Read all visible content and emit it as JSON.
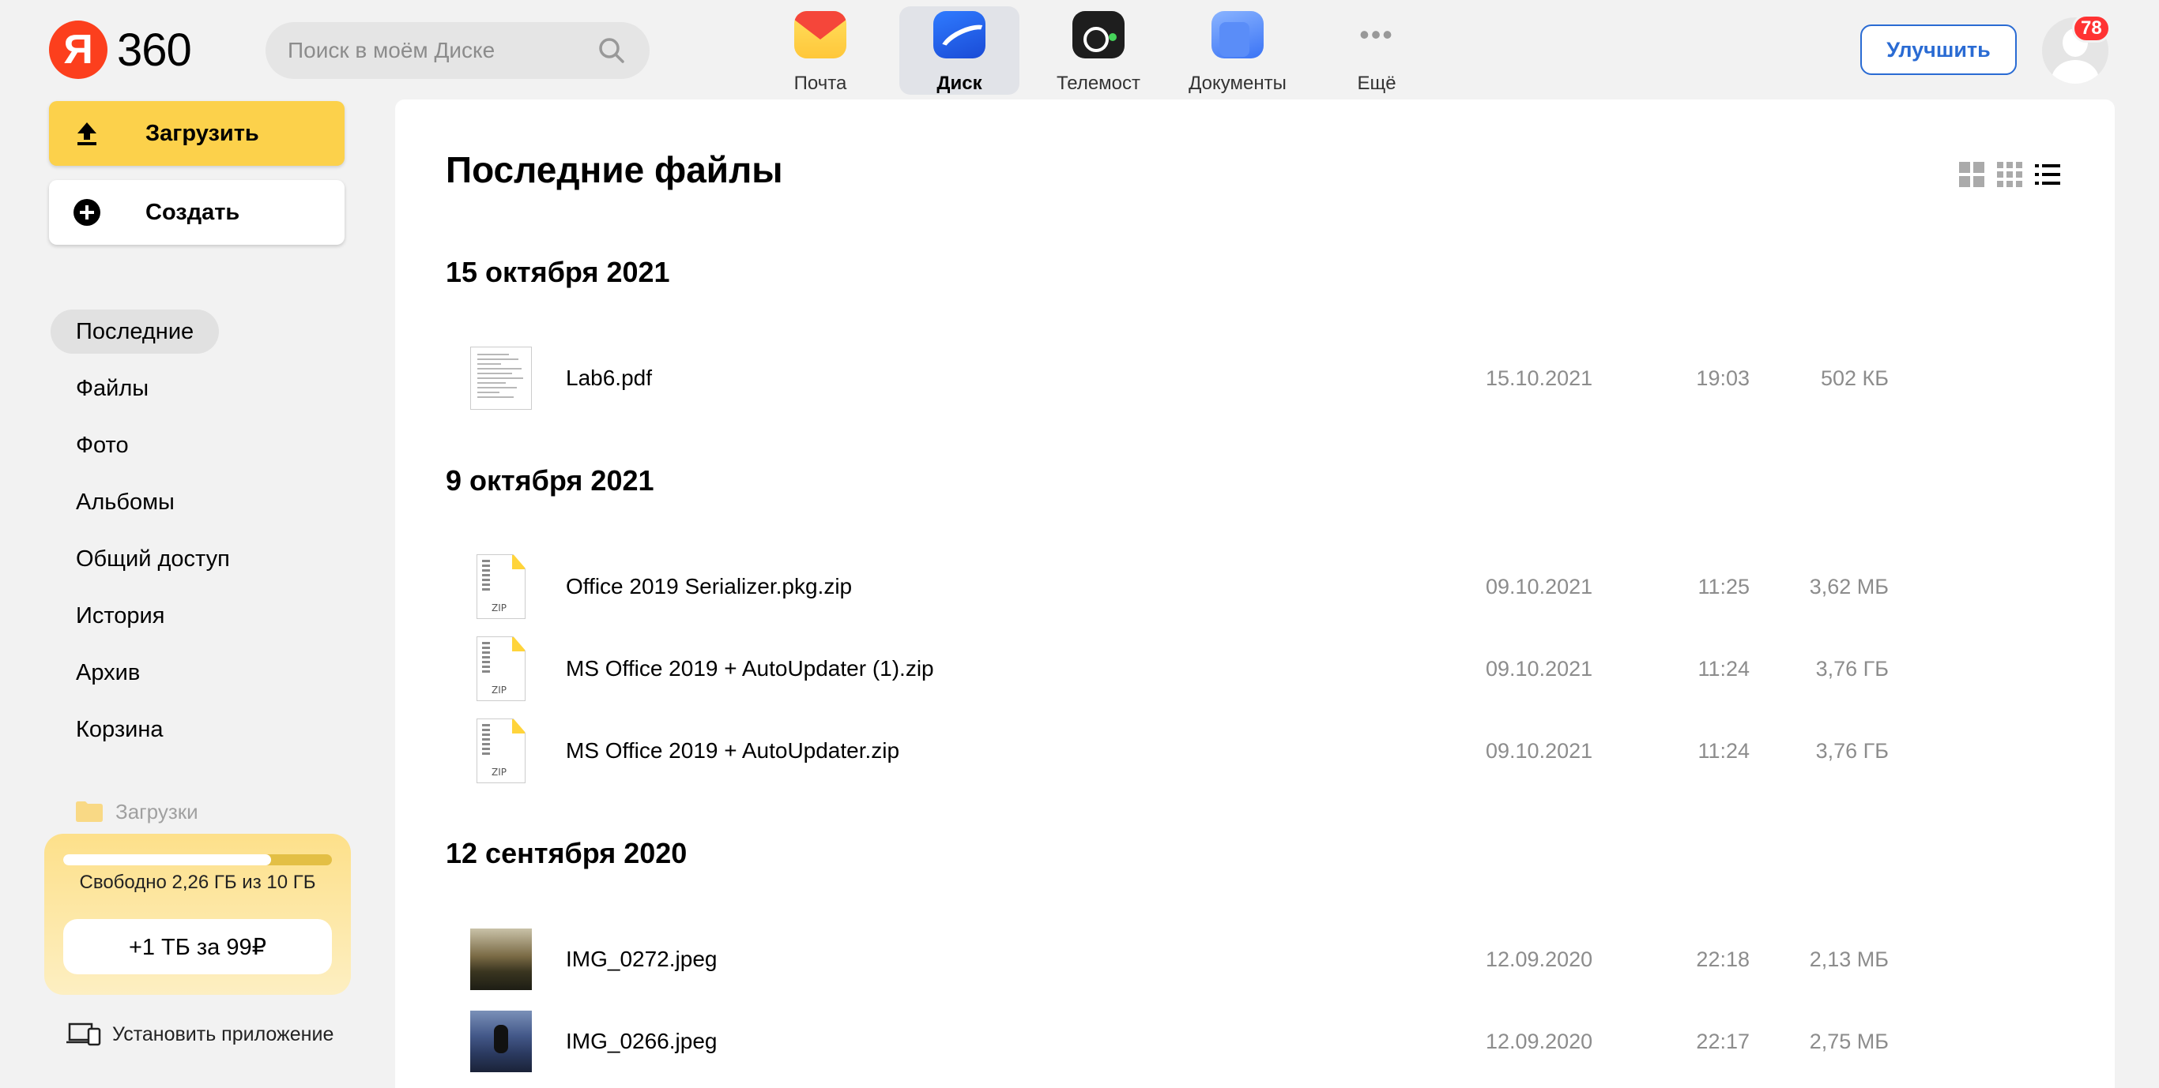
{
  "header": {
    "logo_mark": "Я",
    "logo_text": "360",
    "search_placeholder": "Поиск в моём Диске",
    "apps": [
      {
        "label": "Почта",
        "icon": "mail-icon"
      },
      {
        "label": "Диск",
        "icon": "disk-icon",
        "active": true
      },
      {
        "label": "Телемост",
        "icon": "telemost-icon"
      },
      {
        "label": "Документы",
        "icon": "documents-icon"
      },
      {
        "label": "Ещё",
        "icon": "more-icon"
      }
    ],
    "upgrade_label": "Улучшить",
    "notifications_count": "78",
    "colors": {
      "accent": "#2a6bd3",
      "brand_red": "#fc3f1d",
      "badge": "#ff3333"
    }
  },
  "sidebar": {
    "upload_label": "Загрузить",
    "create_label": "Создать",
    "upload_color": "#fcd14b",
    "items": [
      {
        "label": "Последние",
        "active": true
      },
      {
        "label": "Файлы"
      },
      {
        "label": "Фото"
      },
      {
        "label": "Альбомы"
      },
      {
        "label": "Общий доступ"
      },
      {
        "label": "История"
      },
      {
        "label": "Архив"
      },
      {
        "label": "Корзина"
      }
    ],
    "folder_label": "Загрузки",
    "storage": {
      "text": "Свободно 2,26 ГБ из 10 ГБ",
      "free_fraction": 0.774,
      "buy_label": "+1 ТБ за 99₽"
    },
    "install_label": "Установить приложение"
  },
  "main": {
    "title": "Последние файлы",
    "view_modes": [
      "large-tiles-icon",
      "small-tiles-icon",
      "list-icon"
    ],
    "groups": [
      {
        "title": "15 октября 2021",
        "files": [
          {
            "name": "Lab6.pdf",
            "date": "15.10.2021",
            "time": "19:03",
            "size": "502 КБ",
            "kind": "pdf"
          }
        ]
      },
      {
        "title": "9 октября 2021",
        "files": [
          {
            "name": "Office 2019 Serializer.pkg.zip",
            "date": "09.10.2021",
            "time": "11:25",
            "size": "3,62 МБ",
            "kind": "zip"
          },
          {
            "name": "MS Office 2019 + AutoUpdater (1).zip",
            "date": "09.10.2021",
            "time": "11:24",
            "size": "3,76 ГБ",
            "kind": "zip"
          },
          {
            "name": "MS Office 2019 + AutoUpdater.zip",
            "date": "09.10.2021",
            "time": "11:24",
            "size": "3,76 ГБ",
            "kind": "zip"
          }
        ]
      },
      {
        "title": "12 сентября 2020",
        "files": [
          {
            "name": "IMG_0272.jpeg",
            "date": "12.09.2020",
            "time": "22:18",
            "size": "2,13 МБ",
            "kind": "image"
          },
          {
            "name": "IMG_0266.jpeg",
            "date": "12.09.2020",
            "time": "22:17",
            "size": "2,75 МБ",
            "kind": "image"
          }
        ]
      }
    ],
    "zip_thumb_label": "ZIP"
  }
}
